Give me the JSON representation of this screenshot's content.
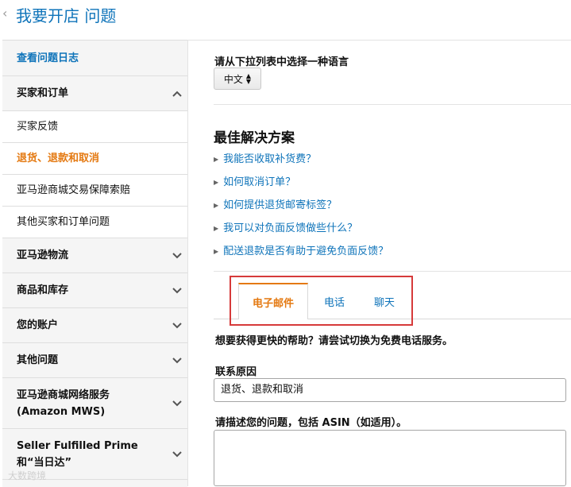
{
  "header": {
    "back_glyph": "‹",
    "title": "我要开店 问题"
  },
  "sidebar": {
    "items": [
      {
        "label": "查看问题日志"
      },
      {
        "label": "买家和订单",
        "icon": "chevron-up-icon"
      },
      {
        "label": "买家反馈"
      },
      {
        "label": "退货、退款和取消"
      },
      {
        "label": "亚马逊商城交易保障索赔"
      },
      {
        "label": "其他买家和订单问题"
      },
      {
        "label": "亚马逊物流",
        "icon": "chevron-down-icon"
      },
      {
        "label": "商品和库存",
        "icon": "chevron-down-icon"
      },
      {
        "label": "您的账户",
        "icon": "chevron-down-icon"
      },
      {
        "label": "其他问题",
        "icon": "chevron-down-icon"
      },
      {
        "label": "亚马逊商城网络服务\n(Amazon MWS)",
        "icon": "chevron-down-icon"
      },
      {
        "label": "Seller Fulfilled Prime\n和“当日达”",
        "icon": "chevron-down-icon"
      }
    ]
  },
  "main": {
    "language_label": "请从下拉列表中选择一种语言",
    "language_selected": "中文",
    "best_solutions_title": "最佳解决方案",
    "faq": [
      "我能否收取补货费？",
      "如何取消订单？",
      "如何提供退货邮寄标签？",
      "我可以对负面反馈做些什么？",
      "配送退款是否有助于避免负面反馈？"
    ],
    "tabs": [
      {
        "label": "电子邮件",
        "active": true
      },
      {
        "label": "电话"
      },
      {
        "label": "聊天"
      }
    ],
    "help_text": "想要获得更快的帮助？请尝试切换为免费电话服务。",
    "contact_reason_label": "联系原因",
    "contact_reason_value": "退货、退款和取消",
    "describe_label": "请描述您的问题，包括 ASIN（如适用）。",
    "describe_value": ""
  },
  "watermark": "大数跨境",
  "colors": {
    "link": "#0f74ba",
    "active": "#e47911",
    "highlight_box": "#d63a3a"
  }
}
